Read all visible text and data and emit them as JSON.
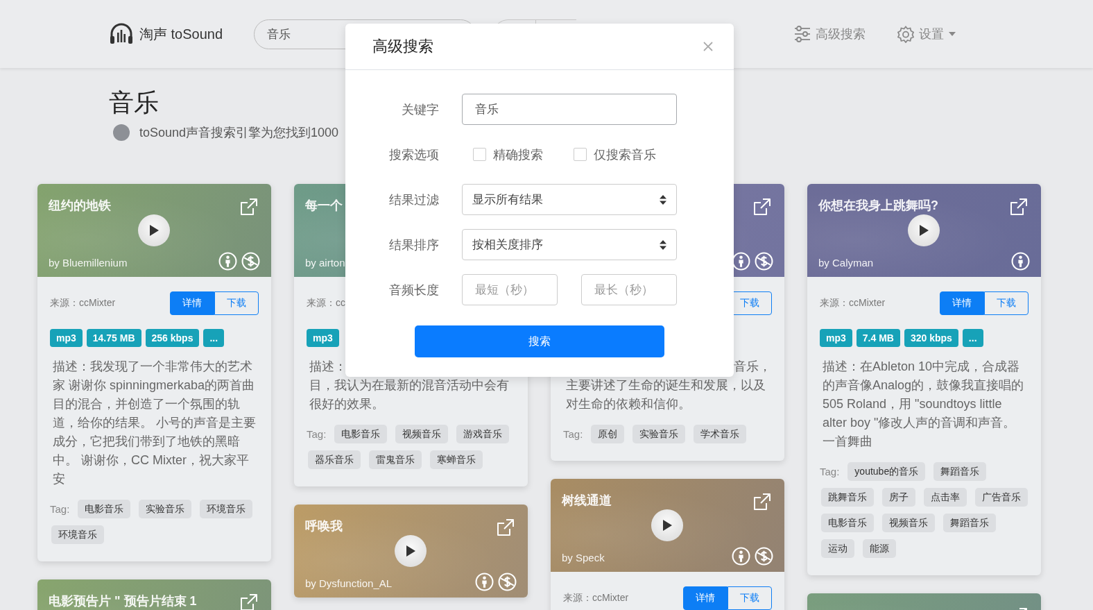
{
  "navbar": {
    "brand": "淘声 toSound",
    "search": {
      "value": "音乐"
    },
    "links": [
      {
        "kind": "filters",
        "label": "高级搜索"
      },
      {
        "kind": "settings",
        "label": "设置",
        "caret": true
      }
    ]
  },
  "results": {
    "title": "音乐",
    "summary": "toSound声音搜索引擎为您找到1000"
  },
  "columns": [
    [
      {
        "title": "纽约的地铁",
        "author": "by Bluemillenium",
        "color": "#84a36e",
        "link": true,
        "play": true,
        "licenses": [
          {
            "kind": "by"
          },
          {
            "kind": "nc"
          }
        ],
        "source": "来源：ccMixter",
        "buttons": [
          {
            "label": "详情",
            "kind": "primary"
          },
          {
            "label": "下载",
            "kind": "outline"
          }
        ],
        "chips": [
          "mp3",
          "14.75 MB",
          "256 kbps",
          "..."
        ],
        "description": "描述：我发现了一个非常伟大的艺术家 谢谢你 spinningmerkaba的两首曲目的混合，并创造了一个氛围的轨道，给你的结果。 小号的声音是主要成分，它把我们带到了地铁的黑暗中。 谢谢你，CC Mixter，祝大家平安",
        "tag_label": "Tag:",
        "tags": [
          "电影音乐",
          "实验音乐",
          "环境音乐",
          "环境音乐"
        ]
      },
      {
        "title": "电影预告片 \" 预告片结束 1",
        "color": "#88a56e",
        "link": true
      }
    ],
    [
      {
        "title": "每一个",
        "author": "by airton",
        "color": "#6f9c88",
        "source": "来源：cc",
        "chips": [
          "mp3"
        ],
        "description_lines": [
          "描述：",
          "目，我认为在最新的混音活动中会有",
          "很好的效果。"
        ],
        "tag_label": "Tag:",
        "tags": [
          "电影音乐",
          "视频音乐",
          "游戏音乐",
          "器乐音乐",
          "雷鬼音乐",
          "寒蝉音乐"
        ]
      },
      {
        "title": "呼唤我",
        "author": "by Dysfunction_AL",
        "color": "#bc9c66",
        "link": true,
        "play": true,
        "licenses": [
          {
            "kind": "by"
          },
          {
            "kind": "nc"
          }
        ]
      }
    ],
    [
      {
        "kind": "behind-dialog",
        "color": "#7b78a2",
        "link": true,
        "licenses": [
          {
            "kind": "by"
          },
          {
            "kind": "nc"
          }
        ],
        "buttons": [
          {
            "label": "下载",
            "kind": "outline"
          }
        ],
        "description_lines": [
          "音乐，",
          "主要讲述了生命的诞生和发展，以及",
          "对生命的依赖和信仰。"
        ],
        "tag_label": "Tag:",
        "tags": [
          "原创",
          "实验音乐",
          "学术音乐"
        ]
      },
      {
        "title": "树线通道",
        "author": "by Speck",
        "color": "#a98d63",
        "link": true,
        "play": true,
        "licenses": [
          {
            "kind": "by"
          },
          {
            "kind": "nc"
          }
        ],
        "source": "来源：ccMixter",
        "buttons": [
          {
            "label": "详情",
            "kind": "primary"
          },
          {
            "label": "下载",
            "kind": "outline"
          }
        ]
      }
    ],
    [
      {
        "title": "你想在我身上跳舞吗?",
        "author": "by Calyman",
        "color": "#6d6d98",
        "link": true,
        "play": true,
        "licenses": [
          {
            "kind": "by"
          }
        ],
        "source": "来源：ccMixter",
        "buttons": [
          {
            "label": "详情",
            "kind": "primary"
          },
          {
            "label": "下载",
            "kind": "outline"
          }
        ],
        "chips": [
          "mp3",
          "7.4 MB",
          "320 kbps",
          "..."
        ],
        "description": "描述：在Ableton 10中完成，合成器的声音像Analog的，鼓像我直接唱的505 Roland，用 \"soundtoys little alter boy \"修改人声的音调和声音。一首舞曲",
        "tag_label": "Tag:",
        "tags": [
          "youtube的音乐",
          "舞蹈音乐",
          "跳舞音乐",
          "房子",
          "点击率",
          "广告音乐",
          "电影音乐",
          "视频音乐",
          "舞蹈音乐",
          "运动",
          "能源"
        ]
      },
      {
        "color": "#7a9e7e",
        "link": true
      }
    ]
  ],
  "dialog": {
    "title": "高级搜索",
    "rows": [
      {
        "kind": "text",
        "label": "关键字",
        "value": "音乐"
      },
      {
        "kind": "checkboxes",
        "label": "搜索选项",
        "options": [
          {
            "label": "精确搜索",
            "checked": false
          },
          {
            "label": "仅搜索音乐",
            "checked": false
          }
        ]
      },
      {
        "kind": "select",
        "label": "结果过滤",
        "value": "显示所有结果"
      },
      {
        "kind": "select",
        "label": "结果排序",
        "value": "按相关度排序"
      },
      {
        "kind": "range",
        "label": "音频长度",
        "fields": [
          {
            "placeholder": "最短（秒）"
          },
          {
            "placeholder": "最长（秒）"
          }
        ]
      }
    ],
    "submit": "搜索"
  }
}
